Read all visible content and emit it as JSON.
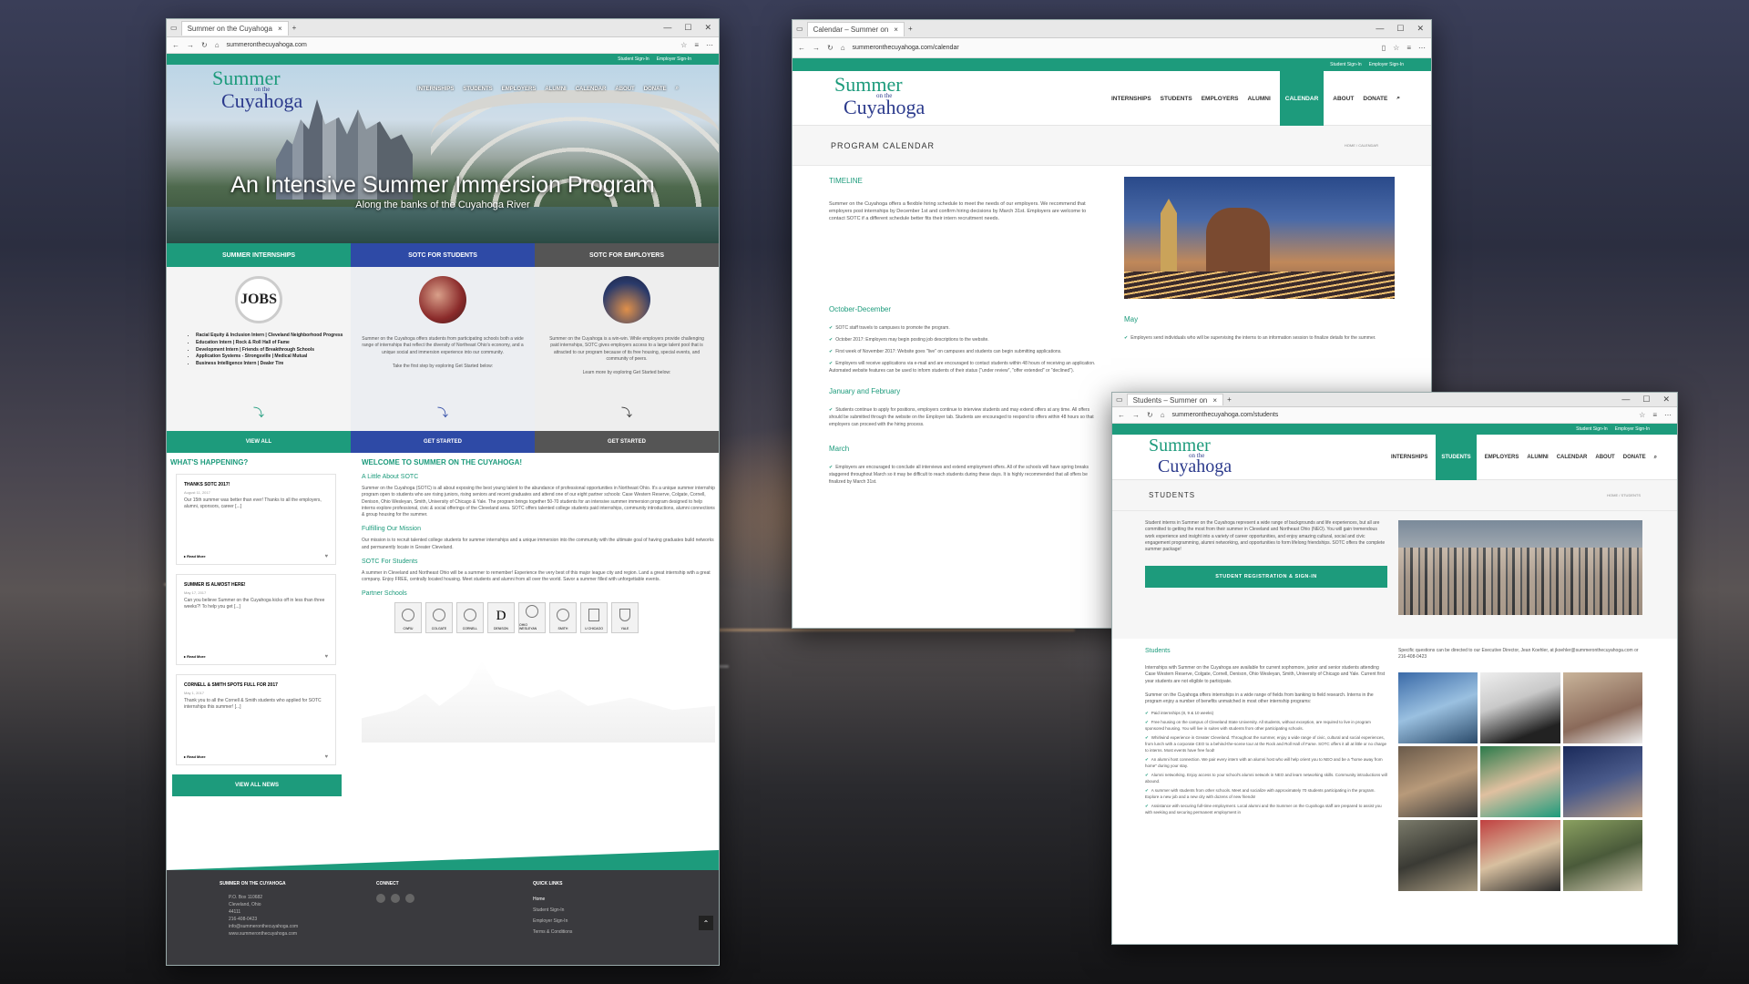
{
  "win1": {
    "tab": "Summer on the Cuyahoga",
    "url": "summeronthecuyahoga.com",
    "util": [
      "Student Sign-In",
      "Employer Sign-In"
    ],
    "logo": [
      "Summer",
      "on the",
      "Cuyahoga"
    ],
    "nav": [
      "INTERNSHIPS",
      "STUDENTS",
      "EMPLOYERS",
      "ALUMNI",
      "CALENDAR",
      "ABOUT",
      "DONATE"
    ],
    "hero_title": "An Intensive Summer Immersion Program",
    "hero_sub": "Along the banks of the Cuyahoga River",
    "cols": [
      {
        "head": "SUMMER INTERNSHIPS",
        "btn": "VIEW ALL",
        "color": "#1d9b7c",
        "items": [
          "Racial Equity & Inclusion Intern | Cleveland Neighborhood Progress",
          "Education Intern | Rock & Roll Hall of Fame",
          "Development Intern | Friends of Breakthrough Schools",
          "Application Systems - Strongsville | Medical Mutual",
          "Business Intelligence Intern | Dealer Tire"
        ],
        "text": ""
      },
      {
        "head": "SOTC FOR STUDENTS",
        "btn": "GET STARTED",
        "color": "#2e4aa6",
        "items": [],
        "text": "Summer on the Cuyahoga offers students from participating schools both a wide range of internships that reflect the diversity of Northeast Ohio's economy, and a unique social and immersion experience into our community.",
        "text2": "Take the first step by exploring Get Started below:"
      },
      {
        "head": "SOTC FOR EMPLOYERS",
        "btn": "GET STARTED",
        "color": "#555",
        "items": [],
        "text": "Summer on the Cuyahoga is a win-win. While employers provide challenging paid internships, SOTC gives employers access to a large talent pool that is attracted to our program because of its free housing, special events, and community of peers.",
        "text2": "Learn more by exploring Get Started below:"
      }
    ],
    "whats": "WHAT'S HAPPENING?",
    "news": [
      {
        "t": "THANKS SOTC 2017!",
        "d": "August 11, 2017",
        "x": "Our 15th summer was better than ever! Thanks to all the employers, alumni, sponsors, career [...]"
      },
      {
        "t": "SUMMER IS ALMOST HERE!",
        "d": "May 17, 2017",
        "x": "Can you believe Summer on the Cuyahoga kicks off in less than three weeks?! To help you get [...]"
      },
      {
        "t": "CORNELL & SMITH SPOTS FULL FOR 2017",
        "d": "May 1, 2017",
        "x": "Thank you to all the Cornell & Smith students who applied for SOTC internships this summer! [...]"
      }
    ],
    "read_more": "Read More",
    "view_news": "VIEW ALL NEWS",
    "welcome": "WELCOME TO SUMMER ON THE CUYAHOGA!",
    "about_h": "A Little About SOTC",
    "about_p": "Summer on the Cuyahoga (SOTC) is all about exposing the best young talent to the abundance of professional opportunities in Northeast Ohio. It's a unique summer internship program open to students who are rising juniors, rising seniors and recent graduates and attend one of our eight partner schools: Case Western Reserve, Colgate, Cornell, Denison, Ohio Wesleyan, Smith, University of Chicago & Yale. The program brings together 50-70 students for an intensive summer immersion program designed to help interns explore professional, civic & social offerings of the Cleveland area. SOTC offers talented college students paid internships, community introductions, alumni connections & group housing for the summer.",
    "mission_h": "Fulfilling Our Mission",
    "mission_p": "Our mission is to recruit talented college students for summer internships and a unique immersion into the community with the ultimate goal of having graduates build networks and permanently locate in Greater Cleveland.",
    "students_h": "SOTC For Students",
    "students_p": "A summer in Cleveland and Northeast Ohio will be a summer to remember! Experience the very best of this major league city and region. Land a great internship with a great company. Enjoy FREE, centrally located housing. Meet students and alumni from all over the world. Savor a summer filled with unforgettable events.",
    "partners_h": "Partner Schools",
    "partners": [
      "CWRU",
      "COLGATE",
      "CORNELL",
      "DENISON",
      "OHIO WESLEYAN",
      "SMITH",
      "U CHICAGO",
      "YALE"
    ],
    "footer": {
      "c1": "SUMMER ON THE CUYAHOGA",
      "c1_lines": [
        "P.O. Box 110682",
        "Cleveland, Ohio",
        "44111",
        "216-408-0423",
        "info@summeronthecuyahoga.com",
        "www.summeronthecuyahoga.com"
      ],
      "c2": "CONNECT",
      "c3": "QUICK LINKS",
      "links": [
        "Home",
        "Student Sign-In",
        "Employer Sign-In",
        "Terms & Conditions"
      ]
    }
  },
  "win2": {
    "tab": "Calendar – Summer on",
    "url": "summeronthecuyahoga.com/calendar",
    "util": [
      "Student Sign-In",
      "Employer Sign-In"
    ],
    "nav": [
      "INTERNSHIPS",
      "STUDENTS",
      "EMPLOYERS",
      "ALUMNI",
      "CALENDAR",
      "ABOUT",
      "DONATE"
    ],
    "title": "PROGRAM CALENDAR",
    "crumb": "HOME / CALENDAR",
    "timeline_h": "TIMELINE",
    "timeline_p": "Summer on the Cuyahoga offers a flexible hiring schedule to meet the needs of our employers. We recommend that employers post internships by December 1st and confirm hiring decisions by March 31st. Employers are welcome to contact SOTC if a different schedule better fits their intern recruitment needs.",
    "od_h": "October-December",
    "od": [
      "SOTC staff travels to campuses to promote the program.",
      "October 2017: Employers may begin posting job descriptions to the website.",
      "First week of November 2017: Website goes \"live\" on campuses and students can begin submitting applications.",
      "Employers will receive applications via e-mail and are encouraged to contact students within 48 hours of receiving an application. Automated website features can be used to inform students of their status (\"under review\", \"offer extended\" or \"declined\")."
    ],
    "jf_h": "January and February",
    "jf": [
      "Students continue to apply for positions, employers continue to interview students and may extend offers at any time. All offers should be submitted through the website on the Employer tab. Students are encouraged to respond to offers within 48 hours so that employers can proceed with the hiring process."
    ],
    "m_h": "March",
    "m": [
      "Employers are encouraged to conclude all interviews and extend employment offers. All of the schools will have spring breaks staggered throughout March so it may be difficult to reach students during these days. It is highly recommended that all offers be finalized by March 31st."
    ],
    "may_h": "May",
    "may": [
      "Employers send individuals who will be supervising the interns to an information session to finalize details for the summer."
    ]
  },
  "win3": {
    "tab": "Students – Summer on",
    "url": "summeronthecuyahoga.com/students",
    "util": [
      "Student Sign-In",
      "Employer Sign-In"
    ],
    "nav": [
      "INTERNSHIPS",
      "STUDENTS",
      "EMPLOYERS",
      "ALUMNI",
      "CALENDAR",
      "ABOUT",
      "DONATE"
    ],
    "title": "STUDENTS",
    "crumb": "HOME / STUDENTS",
    "intro": "Student interns in Summer on the Cuyahoga represent a wide range of backgrounds and life experiences, but all are committed to getting the most from their summer in Cleveland and Northeast Ohio (NEO). You will gain tremendous work experience and insight into a variety of career opportunities, and enjoy amazing cultural, social and civic engagement programming, alumni networking, and opportunities to form lifelong friendships. SOTC offers the complete summer package!",
    "reg_btn": "STUDENT REGISTRATION & SIGN-IN",
    "students_h": "Students",
    "contact": "Specific questions can be directed to our Executive Director, Jean Koehler, at jkoehler@summeronthecuyahoga.com or 216-408-0423",
    "p1": "Internships with Summer on the Cuyahoga are available for current sophomore, junior and senior students attending Case Western Reserve, Colgate, Cornell, Denison, Ohio Wesleyan, Smith, University of Chicago and Yale. Current first year students are not eligible to participate.",
    "p2": "Summer on the Cuyahoga offers internships in a wide range of fields from banking to field research. Interns in the program enjoy a number of benefits unmatched in most other internship programs:",
    "benefits": [
      "Paid internships (8, 9 & 10 weeks)",
      "Free housing on the campus of Cleveland State University. All students, without exception, are required to live in program sponsored housing. You will live in suites with students from other participating schools.",
      "Whirlwind experience in Greater Cleveland. Throughout the summer, enjoy a wide range of civic, cultural and social experiences, from lunch with a corporate CEO to a behind-the-scene tour at the Rock and Roll Hall of Fame. SOTC offers it all at little or no charge to interns. Most events have free food!",
      "An alumni host connection. We pair every intern with an alumni host who will help orient you to NEO and be a \"home away from home\" during your stay.",
      "Alumni networking. Enjoy access to your school's alumni network in NEO and learn networking skills. Community introductions will abound.",
      "A summer with students from other schools. Meet and socialize with approximately 70 students participating in the program. Explore a new job and a new city with dozens of new friends!",
      "Assistance with securing full-time employment. Local alumni and the Summer on the Cuyahoga staff are prepared to assist you with seeking and securing permanent employment in"
    ]
  }
}
